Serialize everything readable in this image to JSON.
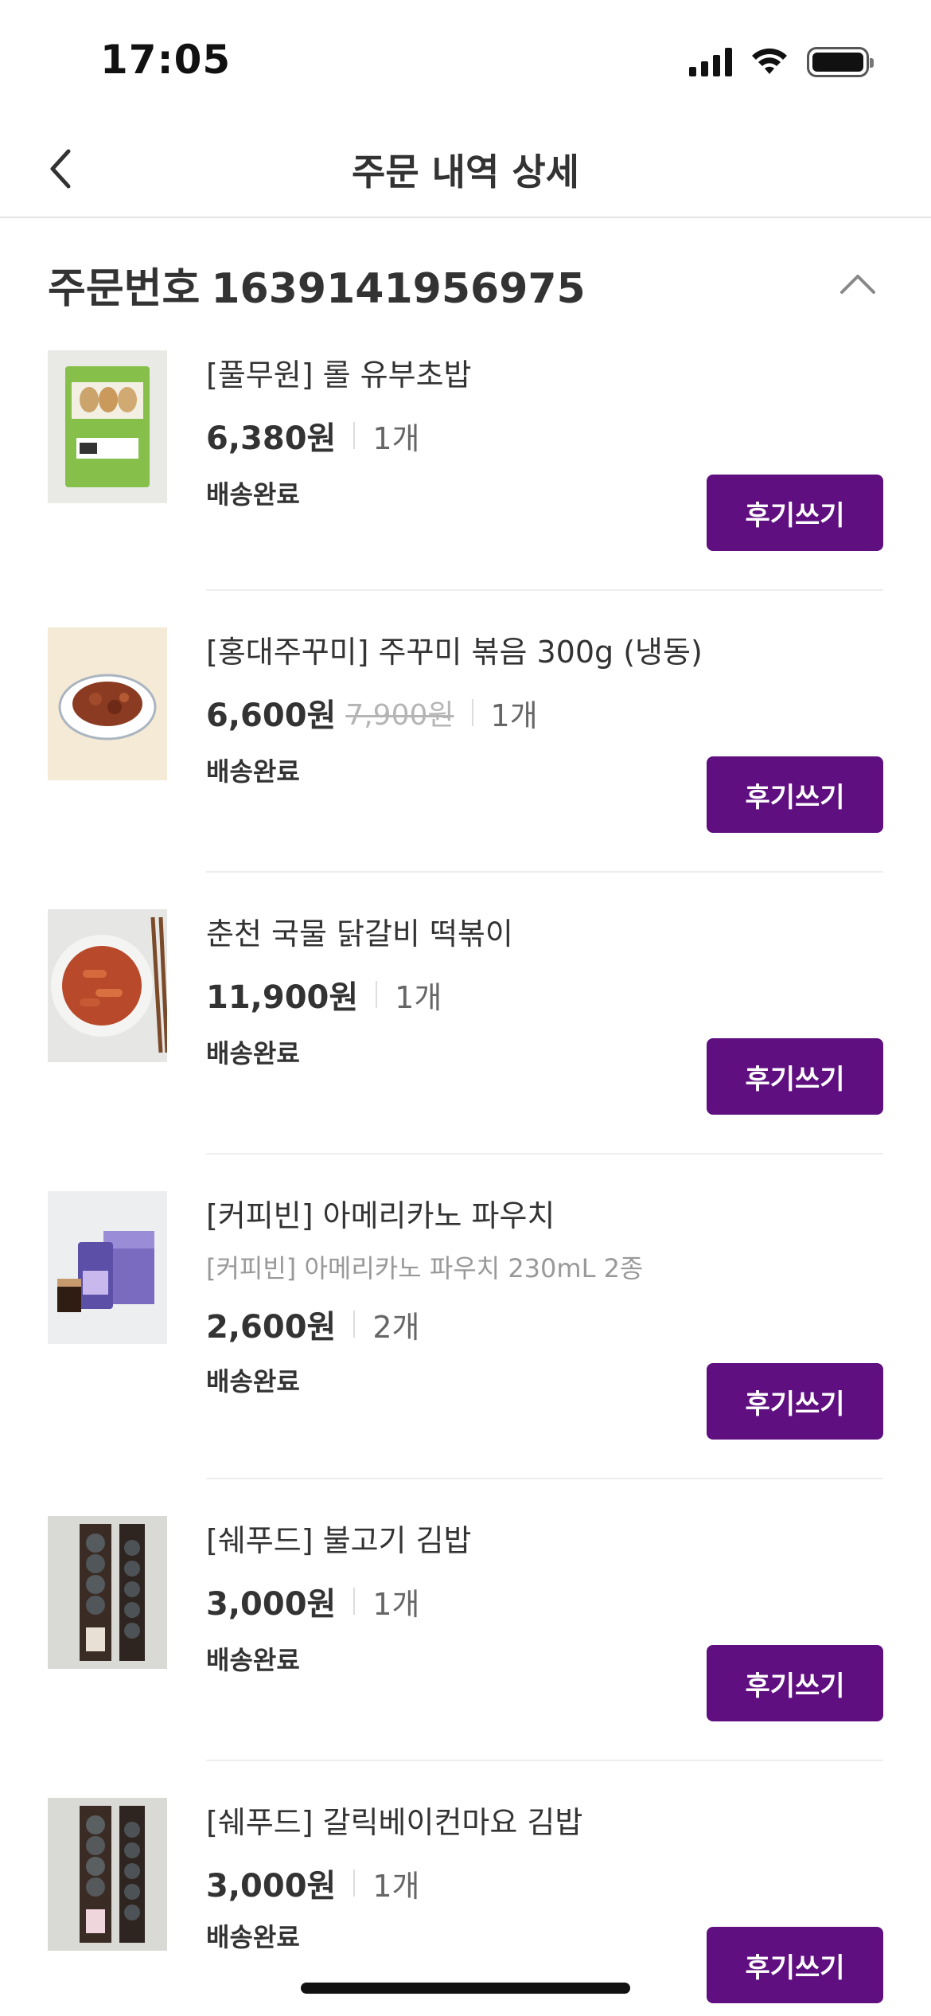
{
  "status_bar": {
    "time": "17:05"
  },
  "header": {
    "title": "주문 내역 상세"
  },
  "order": {
    "label": "주문번호",
    "number": "1639141956975"
  },
  "colors": {
    "accent": "#5f0f80"
  },
  "items": [
    {
      "name": "[풀무원] 롤 유부초밥",
      "price": "6,380원",
      "qty": "1개",
      "status": "배송완료",
      "button": "후기쓰기"
    },
    {
      "name": "[홍대주꾸미] 주꾸미 볶음 300g (냉동)",
      "price": "6,600원",
      "original_price": "7,900원",
      "qty": "1개",
      "status": "배송완료",
      "button": "후기쓰기"
    },
    {
      "name": "춘천 국물 닭갈비 떡볶이",
      "price": "11,900원",
      "qty": "1개",
      "status": "배송완료",
      "button": "후기쓰기"
    },
    {
      "name": "[커피빈] 아메리카노 파우치",
      "option": "[커피빈] 아메리카노 파우치 230mL 2종",
      "price": "2,600원",
      "qty": "2개",
      "status": "배송완료",
      "button": "후기쓰기"
    },
    {
      "name": "[쉐푸드] 불고기 김밥",
      "price": "3,000원",
      "qty": "1개",
      "status": "배송완료",
      "button": "후기쓰기"
    },
    {
      "name": "[쉐푸드] 갈릭베이컨마요 김밥",
      "price": "3,000원",
      "qty": "1개",
      "status": "배송완료",
      "button": "후기쓰기"
    }
  ],
  "icons": {
    "back": "chevron-left-icon",
    "collapse": "chevron-up-icon",
    "signal": "cellular-signal-icon",
    "wifi": "wifi-icon",
    "battery": "battery-icon"
  }
}
